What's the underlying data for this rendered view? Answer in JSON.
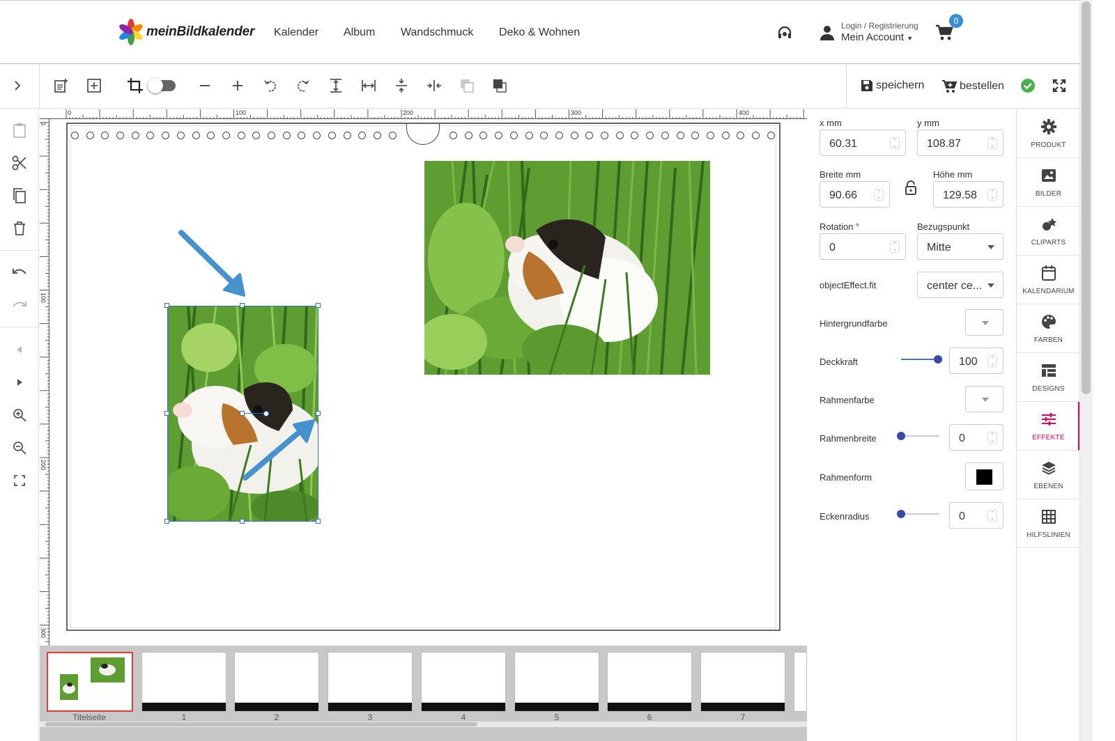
{
  "header": {
    "logo_text": "meinBildkalender",
    "nav": [
      "Kalender",
      "Album",
      "Wandschmuck",
      "Deko & Wohnen"
    ],
    "account_sub": "Login / Registrierung",
    "account_main": "Mein Account",
    "cart_count": "0"
  },
  "toolbar": {
    "save_label": "speichern",
    "order_label": "bestellen"
  },
  "ruler": {
    "top_ticks": [
      "0",
      "100",
      "200",
      "300",
      "400"
    ],
    "left_ticks": [
      "0",
      "100",
      "200",
      "300"
    ]
  },
  "properties": {
    "x_label": "x mm",
    "x_value": "60.31",
    "y_label": "y mm",
    "y_value": "108.87",
    "width_label": "Breite mm",
    "width_value": "90.66",
    "height_label": "Höhe mm",
    "height_value": "129.58",
    "rotation_label": "Rotation °",
    "rotation_value": "0",
    "anchor_label": "Bezugspunkt",
    "anchor_value": "Mitte",
    "fit_label": "objectEffect.fit",
    "fit_value": "center ce...",
    "bgcolor_label": "Hintergrundfarbe",
    "opacity_label": "Deckkraft",
    "opacity_value": "100",
    "bordercolor_label": "Rahmenfarbe",
    "borderwidth_label": "Rahmenbreite",
    "borderwidth_value": "0",
    "bordershape_label": "Rahmenform",
    "radius_label": "Eckenradius",
    "radius_value": "0"
  },
  "right_nav": [
    {
      "label": "PRODUKT",
      "icon": "gear-icon"
    },
    {
      "label": "BILDER",
      "icon": "image-icon"
    },
    {
      "label": "CLIPARTS",
      "icon": "cliparts-icon"
    },
    {
      "label": "KALENDARIUM",
      "icon": "calendar-icon"
    },
    {
      "label": "FARBEN",
      "icon": "palette-icon"
    },
    {
      "label": "DESIGNS",
      "icon": "designs-icon"
    },
    {
      "label": "EFFEKTE",
      "icon": "sliders-icon",
      "active": true
    },
    {
      "label": "EBENEN",
      "icon": "layers-icon"
    },
    {
      "label": "HILFSLINIEN",
      "icon": "grid-icon"
    }
  ],
  "thumbnails": [
    "Titelseite",
    "1",
    "2",
    "3",
    "4",
    "5",
    "6",
    "7"
  ],
  "colors": {
    "accent": "#e6005c",
    "selection": "#2f6fd6",
    "arrow": "#4592cf",
    "check": "#4caf50",
    "cart_badge": "#3a8fd2"
  }
}
